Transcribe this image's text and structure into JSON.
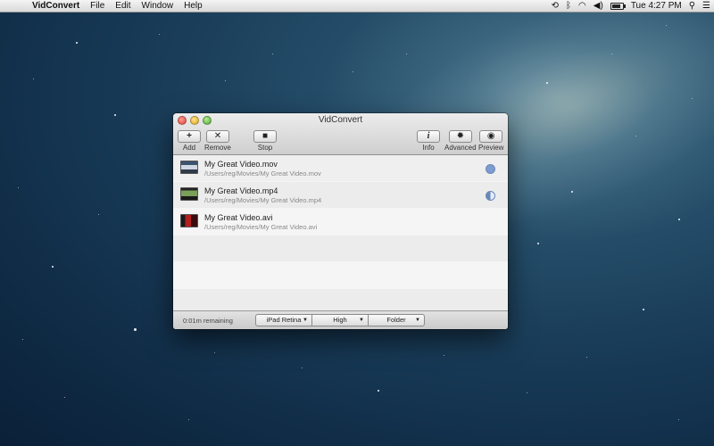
{
  "menubar": {
    "app_name": "VidConvert",
    "items": [
      "File",
      "Edit",
      "Window",
      "Help"
    ],
    "clock": "Tue 4:27 PM"
  },
  "window": {
    "title": "VidConvert",
    "toolbar": {
      "add": "Add",
      "remove": "Remove",
      "stop": "Stop",
      "info": "Info",
      "advanced": "Advanced",
      "preview": "Preview"
    },
    "files": [
      {
        "name": "My Great Video.mov",
        "path": "/Users/reg/Movies/My Great Video.mov",
        "status": "done"
      },
      {
        "name": "My Great Video.mp4",
        "path": "/Users/reg/Movies/My Great Video.mp4",
        "status": "converting"
      },
      {
        "name": "My Great Video.avi",
        "path": "/Users/reg/Movies/My Great Video.avi",
        "status": "queued"
      }
    ],
    "bottom": {
      "remaining": "0:01m remaining",
      "device": "iPad Retina",
      "quality": "High",
      "destination": "Folder"
    }
  },
  "icons": {
    "add": "+",
    "remove": "✕",
    "stop": "■",
    "info": "i",
    "advanced": "✹",
    "preview": "◉"
  }
}
